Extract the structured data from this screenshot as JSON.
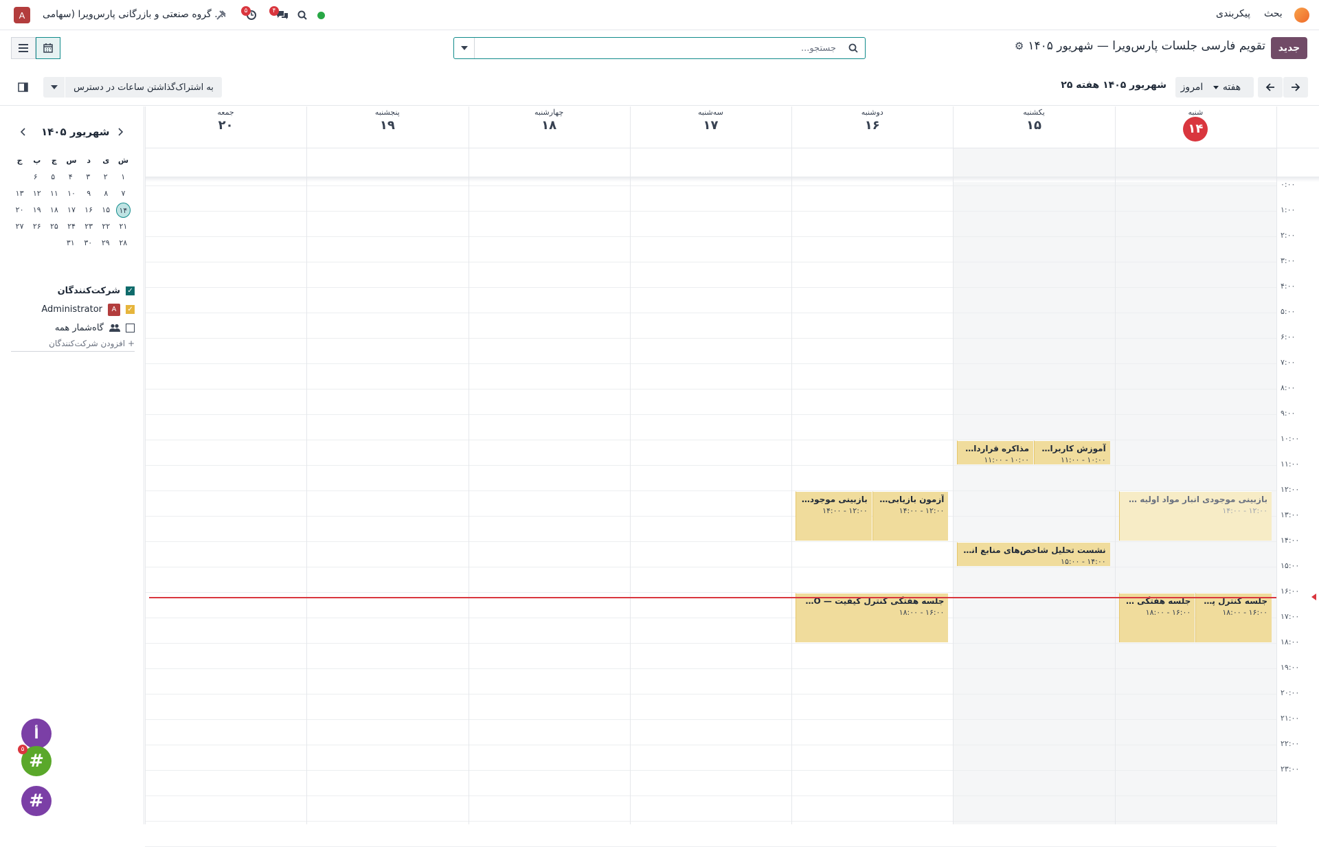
{
  "topbar": {
    "avatar_letter": "A",
    "company": "گروه صنعتی و بازرگانی پارس‌ویرا (سهامی ...",
    "activity_badge": "۵",
    "chat_badge": "۴",
    "menu_config": "پیکربندی",
    "menu_discuss": "بحث",
    "icons": [
      "tools-icon",
      "clock-icon",
      "chat-icon",
      "search-icon",
      "status-dot"
    ]
  },
  "control": {
    "new_button": "جدید",
    "title": "تقویم فارسی جلسات پارس‌ویرا — شهریور ۱۴۰۵",
    "search_placeholder": "جستجو...",
    "today_button": "امروز",
    "scale_button": "هفته",
    "period": "شهریور ۱۴۰۵  هفته ۲۵",
    "share_button": "به اشتراک‌گذاشتن ساعات در دسترس"
  },
  "sidebar": {
    "month_title": "شهریور ۱۴۰۵",
    "weekdays": [
      "ش",
      "ی",
      "د",
      "س",
      "چ",
      "پ",
      "ج"
    ],
    "weeks": [
      [
        "۱",
        "۲",
        "۳",
        "۴",
        "۵",
        "۶"
      ],
      [
        "۷",
        "۸",
        "۹",
        "۱۰",
        "۱۱",
        "۱۲",
        "۱۳"
      ],
      [
        "۱۴",
        "۱۵",
        "۱۶",
        "۱۷",
        "۱۸",
        "۱۹",
        "۲۰"
      ],
      [
        "۲۱",
        "۲۲",
        "۲۳",
        "۲۴",
        "۲۵",
        "۲۶",
        "۲۷"
      ],
      [
        "۲۸",
        "۲۹",
        "۳۰",
        "۳۱"
      ]
    ],
    "attendees_label": "شرکت‌کنندگان",
    "attendee_admin": "Administrator",
    "attendee_admin_letter": "A",
    "attendee_all": "گاه‌شمار همه",
    "add_attendees": "+ افزودن شرکت‌کنندگان"
  },
  "calendar": {
    "days": [
      {
        "name": "شنبه",
        "num": "۱۴"
      },
      {
        "name": "یکشنبه",
        "num": "۱۵"
      },
      {
        "name": "دوشنبه",
        "num": "۱۶"
      },
      {
        "name": "سه‌شنبه",
        "num": "۱۷"
      },
      {
        "name": "چهارشنبه",
        "num": "۱۸"
      },
      {
        "name": "پنجشنبه",
        "num": "۱۹"
      },
      {
        "name": "جمعه",
        "num": "۲۰"
      }
    ],
    "hours": [
      "۰:۰۰",
      "۱:۰۰",
      "۲:۰۰",
      "۳:۰۰",
      "۴:۰۰",
      "۵:۰۰",
      "۶:۰۰",
      "۷:۰۰",
      "۸:۰۰",
      "۹:۰۰",
      "۱۰:۰۰",
      "۱۱:۰۰",
      "۱۲:۰۰",
      "۱۳:۰۰",
      "۱۴:۰۰",
      "۱۵:۰۰",
      "۱۶:۰۰",
      "۱۷:۰۰",
      "۱۸:۰۰",
      "۱۹:۰۰",
      "۲۰:۰۰",
      "۲۱:۰۰",
      "۲۲:۰۰",
      "۲۳:۰۰"
    ],
    "events": [
      {
        "title": "مذاکره قرارداد خد...",
        "time": "۱۰:۰۰ - ۱۱:۰۰"
      },
      {
        "title": "آموزش کاربران واحد ه",
        "time": "۱۰:۰۰ - ۱۱:۰۰"
      },
      {
        "title": "بازبینی موجودی انبار مواد اولیه — DEMO-...",
        "time": "۱۲:۰۰ - ۱۴:۰۰"
      },
      {
        "title": "بازبینی موجودی ا...",
        "time": "۱۲:۰۰ - ۱۴:۰۰"
      },
      {
        "title": "آزمون بازیابی نسخه پ",
        "time": "۱۲:۰۰ - ۱۴:۰۰"
      },
      {
        "title": "نشست تحلیل شاخص‌های منابع انسانی —...",
        "time": "۱۴:۰۰ - ۱۵:۰۰"
      },
      {
        "title": "جلسه هفتگی کنتر...",
        "time": "۱۶:۰۰ - ۱۸:۰۰"
      },
      {
        "title": "جلسه کنترل پروژه اسـ",
        "time": "۱۶:۰۰ - ۱۸:۰۰"
      },
      {
        "title": "جلسه هفتگی کنترل کیفیت — PV-DEMO",
        "time": "۱۶:۰۰ - ۱۸:۰۰"
      }
    ]
  },
  "fabs": {
    "fab1_letter": "أ",
    "fab2_badge": "۵",
    "hash": "#"
  }
}
